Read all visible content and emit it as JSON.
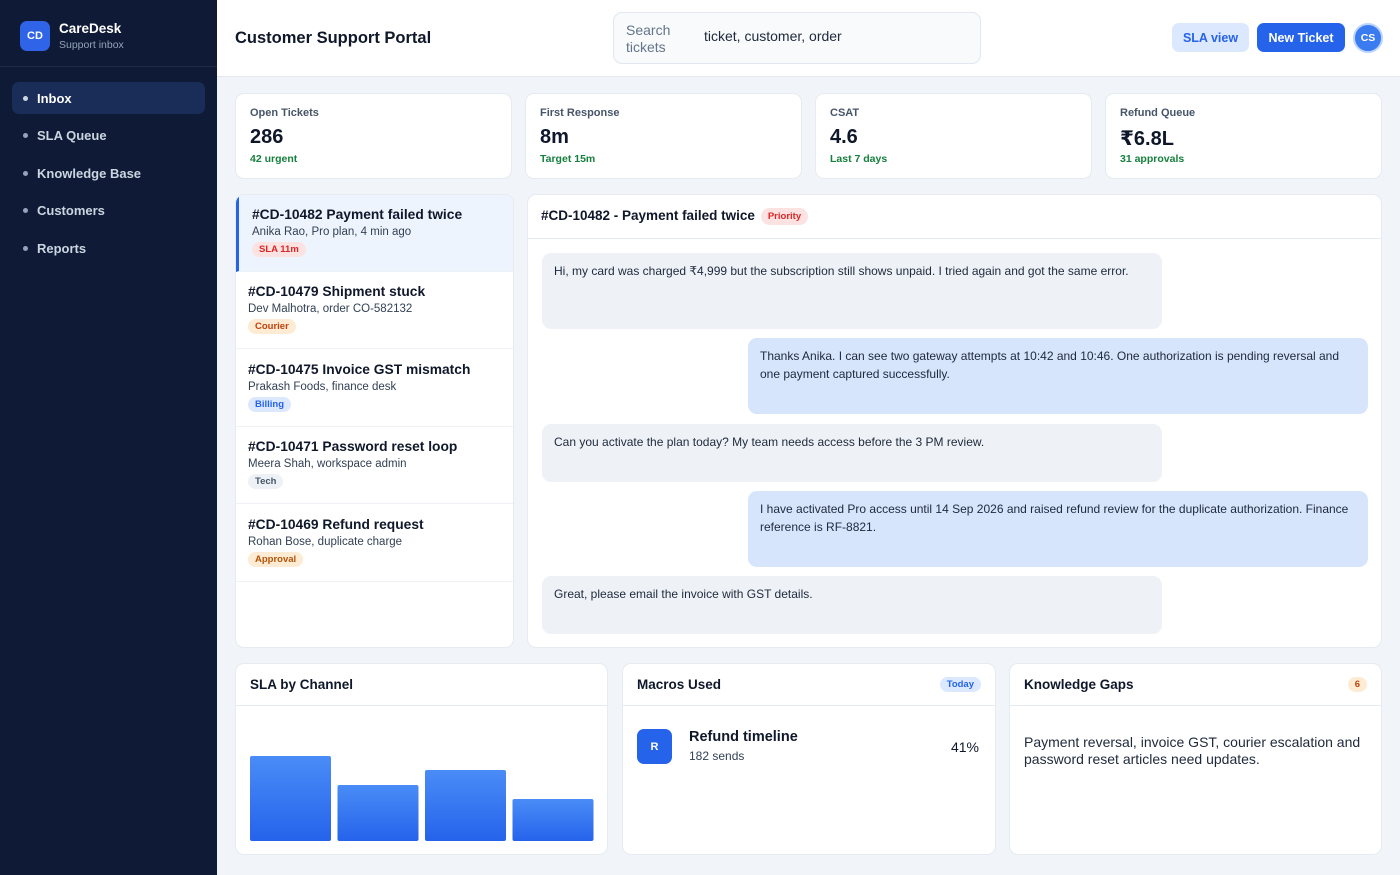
{
  "brand": {
    "logo": "CD",
    "name": "CareDesk",
    "subtitle": "Support inbox"
  },
  "sidebar": {
    "items": [
      {
        "label": "Inbox",
        "active": true
      },
      {
        "label": "SLA Queue"
      },
      {
        "label": "Knowledge Base"
      },
      {
        "label": "Customers"
      },
      {
        "label": "Reports"
      }
    ]
  },
  "header": {
    "title": "Customer Support Portal",
    "search_label": "Search tickets",
    "search_value": "ticket, customer, order",
    "sla_button": "SLA view",
    "new_button": "New Ticket",
    "avatar": "CS"
  },
  "stats": [
    {
      "label": "Open Tickets",
      "value": "286",
      "sub": "42 urgent"
    },
    {
      "label": "First Response",
      "value": "8m",
      "sub": "Target 15m"
    },
    {
      "label": "CSAT",
      "value": "4.6",
      "sub": "Last 7 days"
    },
    {
      "label": "Refund Queue",
      "value": "₹6.8L",
      "sub": "31 approvals"
    }
  ],
  "tickets": [
    {
      "title": "#CD-10482 Payment failed twice",
      "meta": "Anika Rao, Pro plan, 4 min ago",
      "tag": "SLA 11m",
      "tag_bg": "#fde2e2",
      "tag_color": "#dc2626"
    },
    {
      "title": "#CD-10479 Shipment stuck",
      "meta": "Dev Malhotra, order CO-582132",
      "tag": "Courier",
      "tag_bg": "#fdebd3",
      "tag_color": "#c2410c"
    },
    {
      "title": "#CD-10475 Invoice GST mismatch",
      "meta": "Prakash Foods, finance desk",
      "tag": "Billing",
      "tag_bg": "#dbe8fd",
      "tag_color": "#2563eb"
    },
    {
      "title": "#CD-10471 Password reset loop",
      "meta": "Meera Shah, workspace admin",
      "tag": "Tech",
      "tag_bg": "#eef2f6",
      "tag_color": "#475569"
    },
    {
      "title": "#CD-10469 Refund request",
      "meta": "Rohan Bose, duplicate charge",
      "tag": "Approval",
      "tag_bg": "#fdebd3",
      "tag_color": "#b45309"
    }
  ],
  "conversation": {
    "title": "#CD-10482 - Payment failed twice",
    "badge": "Priority",
    "messages": [
      {
        "dir": "in",
        "text": "Hi, my card was charged ₹4,999 but the subscription still shows unpaid. I tried again and got the same error."
      },
      {
        "dir": "out",
        "text": "Thanks Anika. I can see two gateway attempts at 10:42 and 10:46. One authorization is pending reversal and one payment captured successfully."
      },
      {
        "dir": "in",
        "text": "Can you activate the plan today? My team needs access before the 3 PM review."
      },
      {
        "dir": "out",
        "text": "I have activated Pro access until 14 Sep 2026 and raised refund review for the duplicate authorization. Finance reference is RF-8821."
      },
      {
        "dir": "in",
        "text": "Great, please email the invoice with GST details."
      }
    ]
  },
  "sla_panel": {
    "title": "SLA by Channel",
    "chart_data": {
      "type": "bar",
      "values": [
        85,
        56,
        71,
        42
      ],
      "colors": [
        "#3b82f6",
        "#2563eb"
      ]
    }
  },
  "macros_panel": {
    "title": "Macros Used",
    "pill": "Today",
    "item": {
      "icon": "R",
      "title": "Refund timeline",
      "sub": "182 sends",
      "pct": "41%"
    }
  },
  "gaps_panel": {
    "title": "Knowledge Gaps",
    "count": "6",
    "text": "Payment reversal, invoice GST, courier escalation and password reset articles need updates."
  }
}
